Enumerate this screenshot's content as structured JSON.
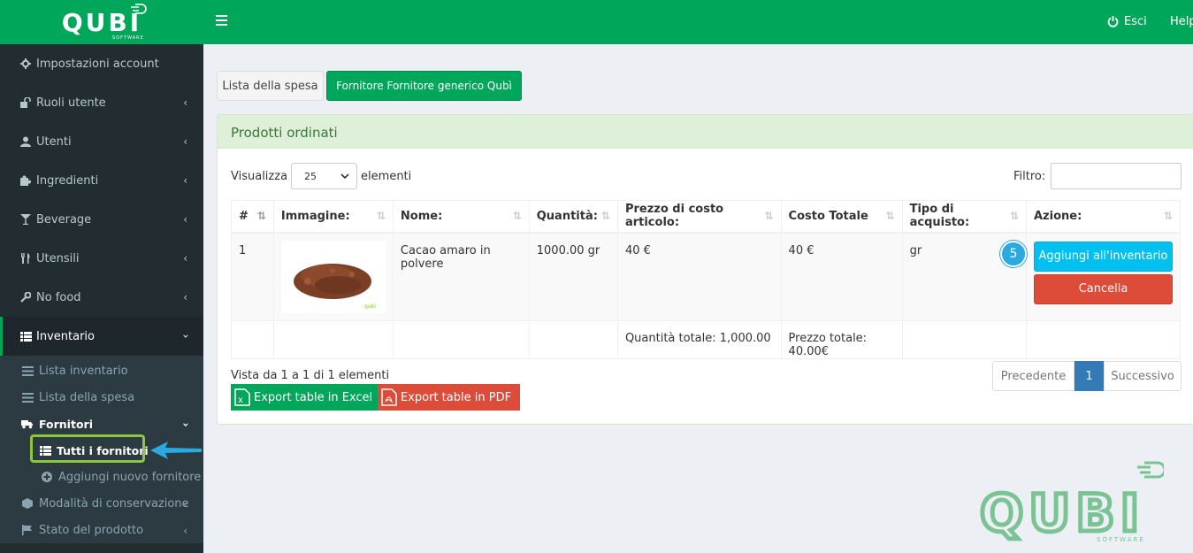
{
  "brand": {
    "name": "QUBI",
    "sub": "SOFTWARE"
  },
  "header": {
    "logout_label": "Esci",
    "help_label": "Help"
  },
  "sidebar": {
    "items": [
      {
        "label": "Impostazioni account",
        "icon": "gear-icon"
      },
      {
        "label": "Ruoli utente",
        "icon": "unlock-icon"
      },
      {
        "label": "Utenti",
        "icon": "user-icon"
      },
      {
        "label": "Ingredienti",
        "icon": "puzzle-icon"
      },
      {
        "label": "Beverage",
        "icon": "cocktail-icon"
      },
      {
        "label": "Utensili",
        "icon": "cutlery-icon"
      },
      {
        "label": "No food",
        "icon": "wrench-icon"
      },
      {
        "label": "Inventario",
        "icon": "list-icon"
      }
    ],
    "inventario_sub": [
      {
        "label": "Lista inventario"
      },
      {
        "label": "Lista della spesa"
      },
      {
        "label": "Fornitori"
      },
      {
        "label": "Modalità di conservazione"
      },
      {
        "label": "Stato del prodotto"
      }
    ],
    "fornitori_sub": [
      {
        "label": "Tutti i fornitori"
      },
      {
        "label": "Aggiungi nuovo fornitore"
      }
    ]
  },
  "tabs": {
    "shopping_list": "Lista della spesa",
    "supplier": "Fornitore Fornitore generico Qubì"
  },
  "panel": {
    "title": "Prodotti ordinati"
  },
  "table_controls": {
    "show_prefix": "Visualizza",
    "show_value": "25",
    "show_suffix": "elementi",
    "filter_label": "Filtro:"
  },
  "table": {
    "headers": [
      "#",
      "Immagine:",
      "Nome:",
      "Quantità:",
      "Prezzo di costo articolo:",
      "Costo Totale",
      "Tipo di acquisto:",
      "Azione:"
    ],
    "rows": [
      {
        "num": "1",
        "name": "Cacao amaro in polvere",
        "qty": "1000.00 gr",
        "unit_price": "40 €",
        "total": "40 €",
        "purchase_type": "gr"
      }
    ],
    "totals": {
      "qty": "Quantità totale: 1,000.00",
      "price": "Prezzo totale: 40.00€"
    },
    "actions": {
      "add": "Aggiungi all'inventario",
      "delete": "Cancella"
    },
    "image_watermark": "qubi"
  },
  "footer": {
    "info": "Vista da 1 a 1 di 1 elementi",
    "export_excel": "Export table in Excel",
    "export_pdf": "Export table in PDF",
    "prev": "Precedente",
    "page": "1",
    "next": "Successivo"
  },
  "annotation": {
    "step": "5"
  },
  "colors": {
    "primary": "#00a65a",
    "sidebar": "#222d32",
    "info": "#00c0ef",
    "danger": "#dd4b39",
    "highlight": "#8dc63f",
    "arrow": "#29a9e0"
  }
}
